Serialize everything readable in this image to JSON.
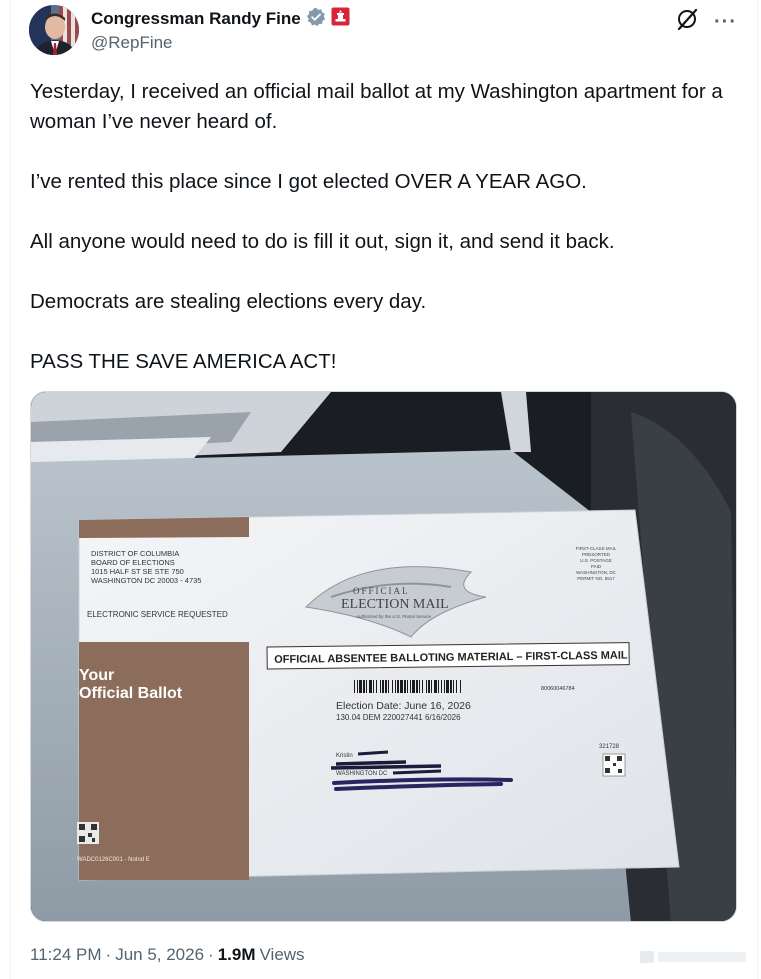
{
  "author": {
    "name": "Congressman Randy Fine",
    "handle": "@RepFine"
  },
  "tweet": {
    "paragraphs": [
      "Yesterday, I received an official mail ballot at my Washington apartment for a woman I’ve never heard of.",
      "I’ve rented this place since I got elected OVER A YEAR AGO.",
      "All anyone would need to do is fill it out, sign it, and send it back.",
      "Democrats are stealing elections every day.",
      "PASS THE SAVE AMERICA ACT!"
    ]
  },
  "envelope": {
    "return_address": [
      "DISTRICT OF COLUMBIA",
      "BOARD OF ELECTIONS",
      "1015 HALF ST SE STE 750",
      "WASHINGTON DC 20003 - 4735"
    ],
    "service_note": "ELECTRONIC SERVICE REQUESTED",
    "ballot_label_1": "Your",
    "ballot_label_2": "Official Ballot",
    "postage": [
      "FIRST-CLASS MAIL",
      "PRESORTED",
      "U.S. POSTAGE",
      "PAID",
      "WASHINGTON, DC",
      "PERMIT NO. 5517"
    ],
    "seal_line_1": "OFFICIAL",
    "seal_line_2": "ELECTION MAIL",
    "seal_line_3": "Authorized by the U.S. Postal Service",
    "banner": "OFFICIAL ABSENTEE BALLOTING MATERIAL – FIRST-CLASS MAIL",
    "barcode_number": "80060046784",
    "election_date": "Election Date:  June 16, 2026",
    "ballot_line": "130.04   DEM      220027441   6/16/2026",
    "recipient_prefix": "Kristin",
    "recipient_city": "WASHINGTON DC",
    "route_code": "321728",
    "footer_code": "WADC0126C001 - NoInd E"
  },
  "meta": {
    "time": "11:24 PM",
    "date": "Jun 5, 2026",
    "views_count": "1.9M",
    "views_label": "Views",
    "separator": "·"
  },
  "colors": {
    "verified": "#829aab",
    "link_gray": "#536471",
    "envelope_brown": "#8c6d5b",
    "flag_red": "#d9253a"
  },
  "icons": {
    "verified": "verified-badge-icon",
    "affiliation": "congress-affiliation-icon",
    "grok": "grok-icon",
    "more": "more-icon"
  }
}
